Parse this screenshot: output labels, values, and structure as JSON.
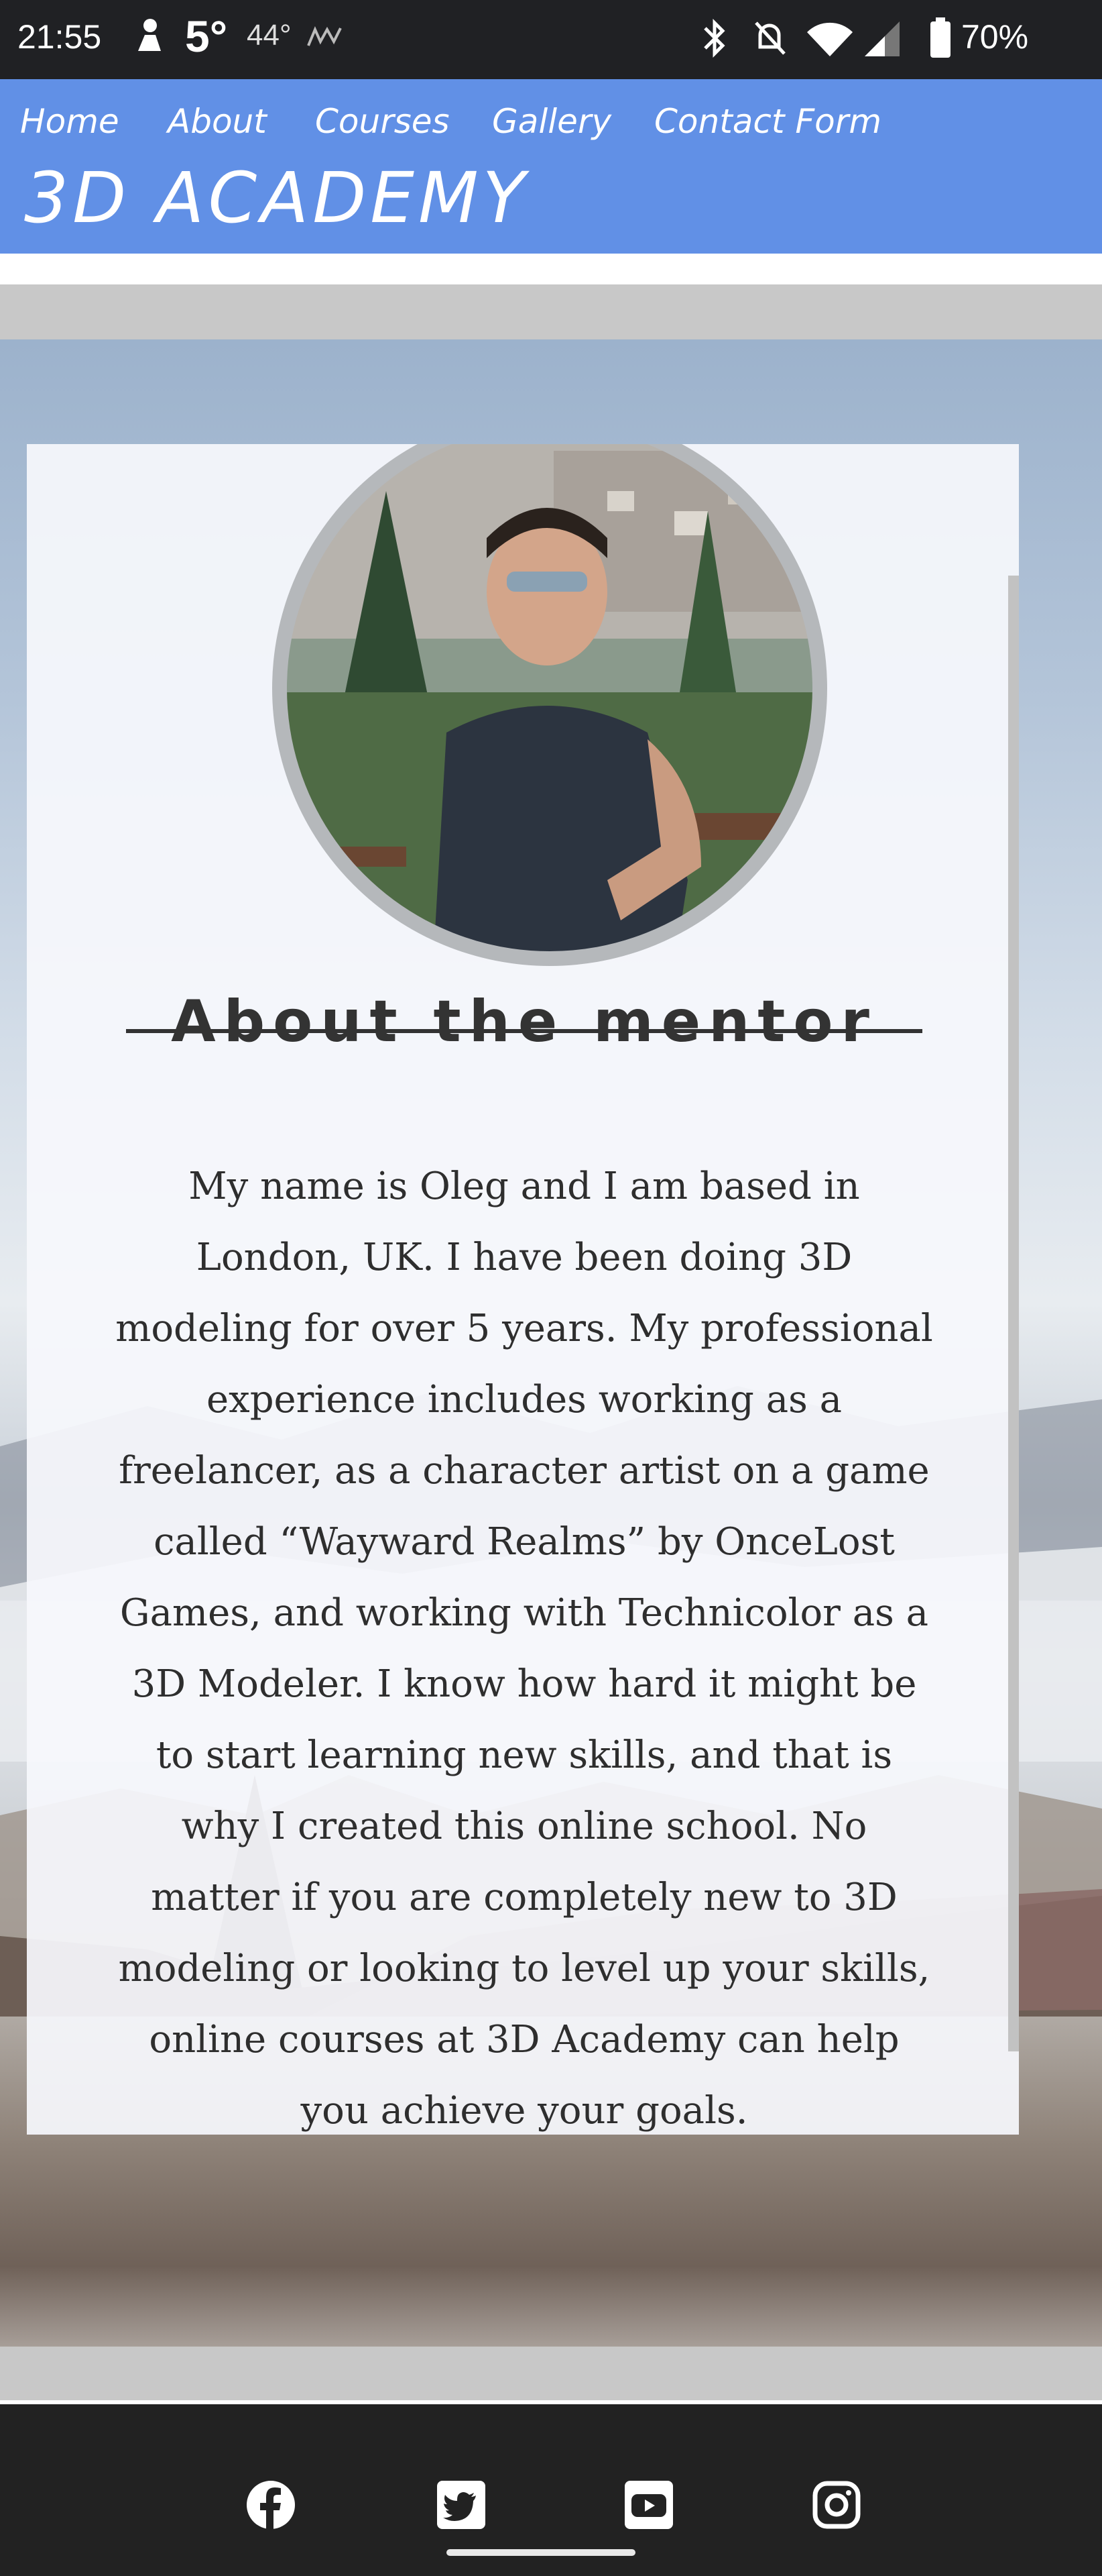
{
  "status_bar": {
    "time": "21:55",
    "temperature_main": "5°",
    "temperature_secondary": "44°",
    "battery": "70%",
    "icons": [
      "notification-icon",
      "weather-icon",
      "bluetooth-icon",
      "bell-off-icon",
      "wifi-icon",
      "signal-icon",
      "battery-icon"
    ]
  },
  "header": {
    "nav": [
      "Home",
      "About",
      "Courses",
      "Gallery",
      "Contact Form"
    ],
    "brand": "3D ACADEMY",
    "accent_color": "#6190e6"
  },
  "about": {
    "heading": "About the mentor",
    "bio": "My name is Oleg and I am based in London, UK. I have been doing 3D modeling for over 5 years. My professional experience includes working as a freelancer, as a character artist on a game called “Wayward Realms” by OnceLost Games, and working with Technicolor as a 3D Modeler. I know how hard it might be to start learning new skills, and that is why I created this online school. No matter if you are completely new to 3D modeling or looking to level up your skills, online courses at 3D Academy can help you achieve your goals."
  },
  "footer": {
    "social": [
      "facebook-icon",
      "twitter-icon",
      "youtube-icon",
      "instagram-icon"
    ]
  }
}
